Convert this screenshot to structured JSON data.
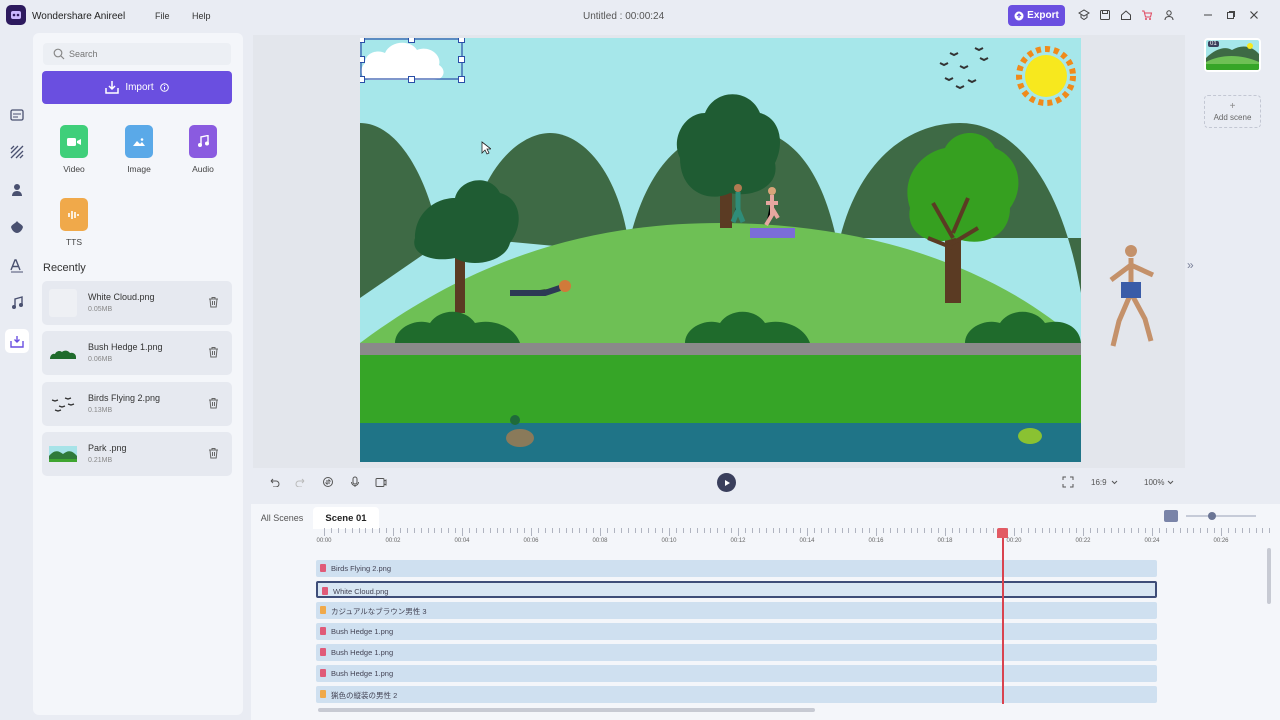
{
  "app": {
    "name": "Wondershare Anireel",
    "document_title": "Untitled : 00:00:24"
  },
  "menu": {
    "file": "File",
    "help": "Help"
  },
  "toolbar": {
    "export_label": "Export",
    "icons": [
      "tutorial-icon",
      "save-icon",
      "home-icon",
      "cart-icon",
      "account-icon",
      "minimize-icon",
      "maximize-icon",
      "close-icon"
    ]
  },
  "sidebar_nav": [
    "template-icon",
    "background-icon",
    "character-icon",
    "prop-icon",
    "text-icon",
    "music-icon",
    "my-media-icon"
  ],
  "library": {
    "search_placeholder": "Search",
    "import_label": "Import",
    "media_types": [
      {
        "label": "Video",
        "color": "#3fcf7a"
      },
      {
        "label": "Image",
        "color": "#5aa9e8"
      },
      {
        "label": "Audio",
        "color": "#8a5be0"
      },
      {
        "label": "TTS",
        "color": "#f0a94a"
      }
    ],
    "recently_title": "Recently",
    "recent_assets": [
      {
        "name": "White Cloud.png",
        "size": "0.05MB"
      },
      {
        "name": "Bush Hedge 1.png",
        "size": "0.06MB"
      },
      {
        "name": "Birds Flying 2.png",
        "size": "0.13MB"
      },
      {
        "name": "Park .png",
        "size": "0.21MB"
      }
    ]
  },
  "canvas": {
    "aspect_ratio": "16:9",
    "zoom": "100%"
  },
  "scenes_panel": {
    "scene_badge": "01",
    "add_scene_label": "Add scene"
  },
  "timeline": {
    "tabs": [
      "All Scenes",
      "Scene 01"
    ],
    "ruler_labels": [
      "00:00",
      "00:02",
      "00:04",
      "00:06",
      "00:08",
      "00:10",
      "00:12",
      "00:14",
      "00:16",
      "00:18",
      "00:20",
      "00:22",
      "00:24",
      "00:26"
    ],
    "playhead_time_seconds": 20,
    "tracks": [
      {
        "name": "Birds Flying 2.png",
        "kind": "image"
      },
      {
        "name": "White Cloud.png",
        "kind": "image",
        "selected": true
      },
      {
        "name": "カジュアルなブラウン男性 3",
        "kind": "character"
      },
      {
        "name": "Bush Hedge 1.png",
        "kind": "image"
      },
      {
        "name": "Bush Hedge 1.png",
        "kind": "image"
      },
      {
        "name": "Bush Hedge 1.png",
        "kind": "image"
      },
      {
        "name": "猟色の縦装の男性 2",
        "kind": "character"
      }
    ]
  }
}
